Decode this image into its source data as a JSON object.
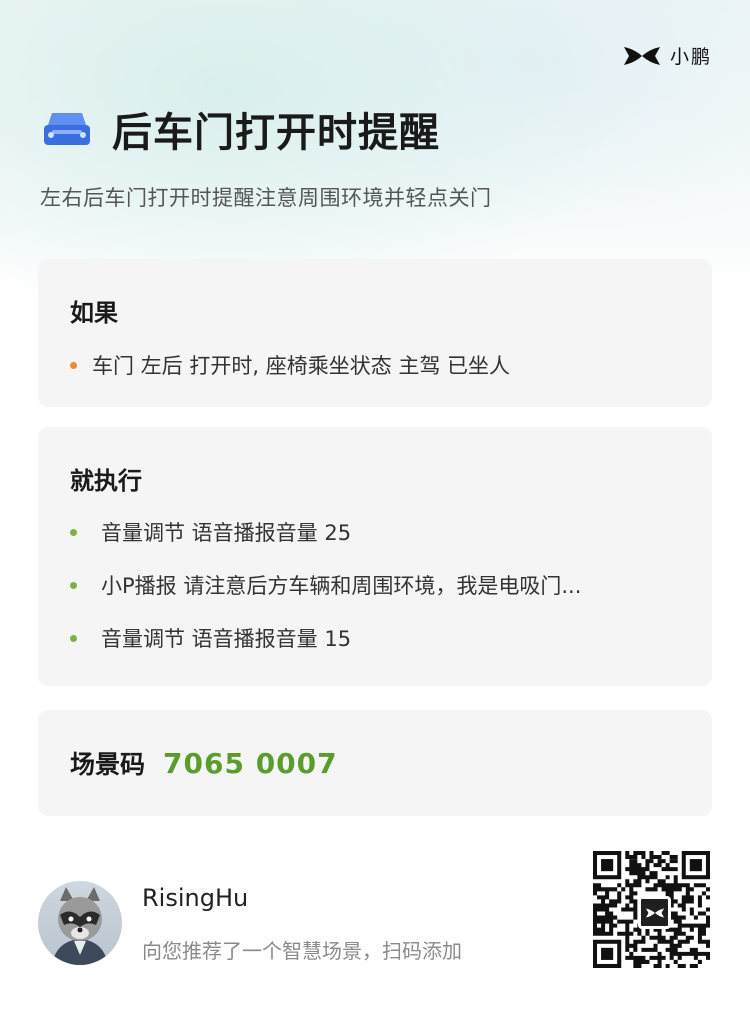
{
  "brand": {
    "name": "小鹏",
    "logo_icon": "xpeng-logo-icon"
  },
  "header": {
    "icon": "car-icon",
    "title": "后车门打开时提醒",
    "subtitle": "左右后车门打开时提醒注意周围环境并轻点关门"
  },
  "condition": {
    "heading": "如果",
    "items": [
      "车门 左后 打开时, 座椅乘坐状态 主驾 已坐人"
    ],
    "bullet_color": "#f08a2a"
  },
  "actions": {
    "heading": "就执行",
    "items": [
      "音量调节 语音播报音量 25",
      "小P播报 请注意后方车辆和周围环境，我是电吸门...",
      "音量调节 语音播报音量 15"
    ],
    "bullet_color": "#7cb342"
  },
  "scene_code": {
    "label": "场景码",
    "value": "7065 0007",
    "color": "#5a9d2b"
  },
  "footer": {
    "user_name": "RisingHu",
    "recommend_text": "向您推荐了一个智慧场景，扫码添加",
    "avatar_icon": "raccoon-avatar",
    "qr_icon": "qr-code-icon"
  },
  "colors": {
    "accent_blue": "#3b6fe0",
    "card_bg": "#f5f5f5"
  }
}
